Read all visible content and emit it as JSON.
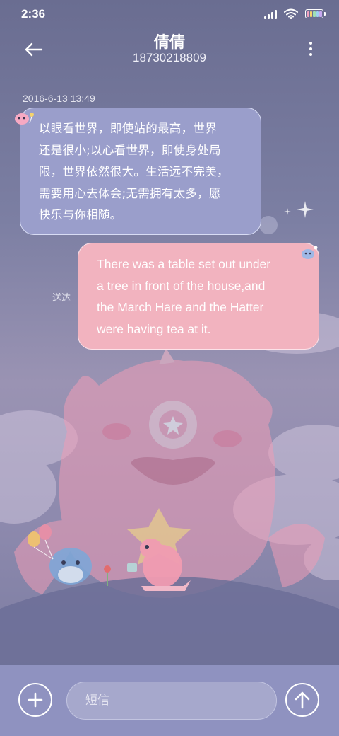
{
  "status_bar": {
    "time": "2:36",
    "icons": [
      "signal-icon",
      "wifi-icon",
      "battery-icon"
    ]
  },
  "header": {
    "contact_name": "倩倩",
    "contact_number": "18730218809",
    "back_icon": "arrow-left-icon",
    "more_icon": "more-vertical-icon"
  },
  "conversation": {
    "timestamp": "2016-6-13 13:49",
    "messages": [
      {
        "direction": "incoming",
        "lines": [
          "以眼看世界，即使站的最高，世界",
          "还是很小;以心看世界，即使身处局",
          "限，世界依然很大。生活远不完美，",
          "需要用心去体会;无需拥有太多，愿",
          "快乐与你相随。"
        ]
      },
      {
        "direction": "outgoing",
        "status": "送达",
        "lines": [
          "There was a table set out under",
          "a tree in front of the house,and",
          "the March Hare and the Hatter",
          "were having tea at it."
        ]
      }
    ]
  },
  "input_bar": {
    "placeholder": "短信",
    "add_icon": "plus-icon",
    "send_icon": "arrow-up-icon"
  },
  "colors": {
    "background": "#6e7196",
    "incoming_bubble": "#9a9ecb",
    "outgoing_bubble": "#f2b3bf",
    "input_bar": "#8f92c0",
    "battery_stripes": [
      "#f3a3c2",
      "#f7d36a",
      "#9fe0b3",
      "#9fd0f2",
      "#c8a9f0"
    ]
  }
}
